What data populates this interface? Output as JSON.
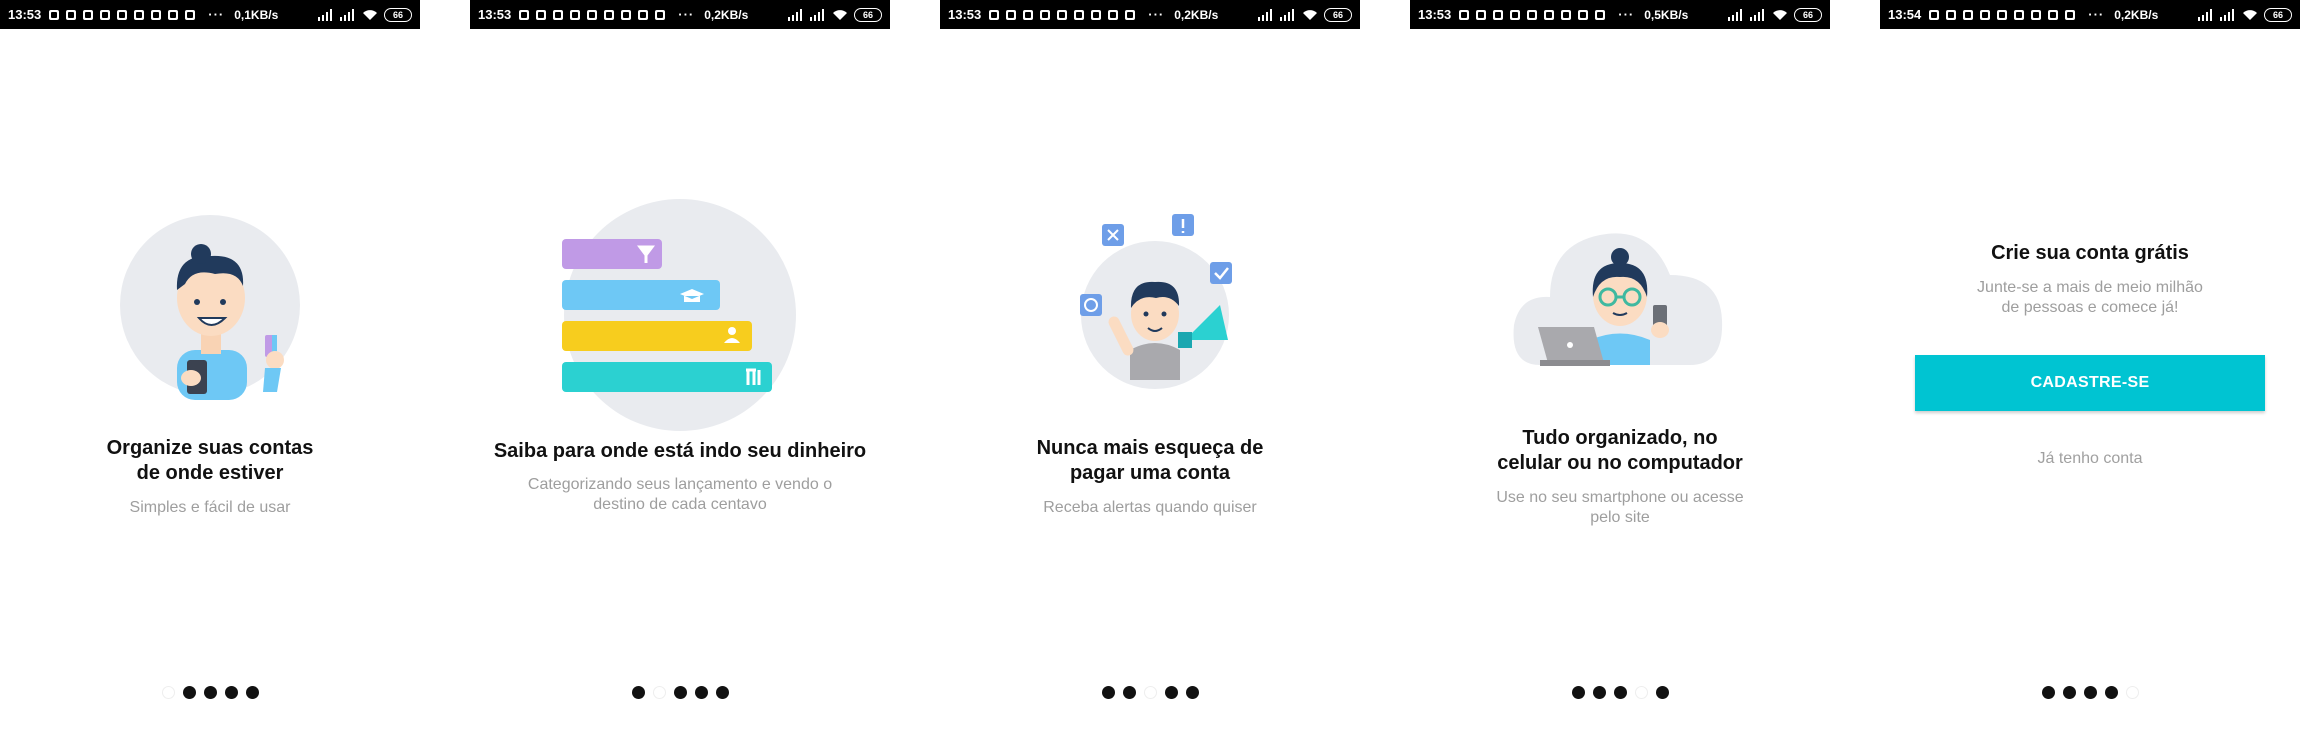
{
  "status_bars": [
    {
      "time": "13:53",
      "speed": "0,1KB/s",
      "battery": "66"
    },
    {
      "time": "13:53",
      "speed": "0,2KB/s",
      "battery": "66"
    },
    {
      "time": "13:53",
      "speed": "0,2KB/s",
      "battery": "66"
    },
    {
      "time": "13:53",
      "speed": "0,5KB/s",
      "battery": "66"
    },
    {
      "time": "13:54",
      "speed": "0,2KB/s",
      "battery": "66"
    }
  ],
  "status_icons": [
    "facebook-icon",
    "chat-icon",
    "chat-icon",
    "chat-icon",
    "whatsapp-icon",
    "link-icon",
    "sync-icon",
    "linkedin-icon",
    "youtube-icon"
  ],
  "screens": [
    {
      "title_lines": [
        "Organize suas contas",
        "de onde estiver"
      ],
      "subtitle_lines": [
        "Simples e fácil de usar"
      ]
    },
    {
      "title_lines": [
        "Saiba para onde está indo seu dinheiro"
      ],
      "subtitle_lines": [
        "Categorizando seus lançamento e vendo o",
        "destino de cada centavo"
      ]
    },
    {
      "title_lines": [
        "Nunca mais esqueça de",
        "pagar uma conta"
      ],
      "subtitle_lines": [
        "Receba alertas quando quiser"
      ]
    },
    {
      "title_lines": [
        "Tudo organizado, no",
        "celular ou no computador"
      ],
      "subtitle_lines": [
        "Use no seu smartphone ou acesse",
        "pelo site"
      ]
    },
    {
      "title_lines": [
        "Crie sua conta grátis"
      ],
      "subtitle_lines": [
        "Junte-se a mais de meio milhão",
        "de pessoas e comece já!"
      ],
      "cta_label": "CADASTRE-SE",
      "login_label": "Já tenho conta"
    }
  ],
  "pager": {
    "total": 5,
    "active_index_per_screen": [
      0,
      1,
      2,
      3,
      4
    ]
  },
  "colors": {
    "accent": "#00c4d2",
    "purple": "#c09ae6",
    "blue": "#6ec8f5",
    "yellow": "#f7cd1e",
    "teal": "#2bd1d1",
    "circle_bg": "#e9ebef",
    "hair": "#213a5c"
  }
}
